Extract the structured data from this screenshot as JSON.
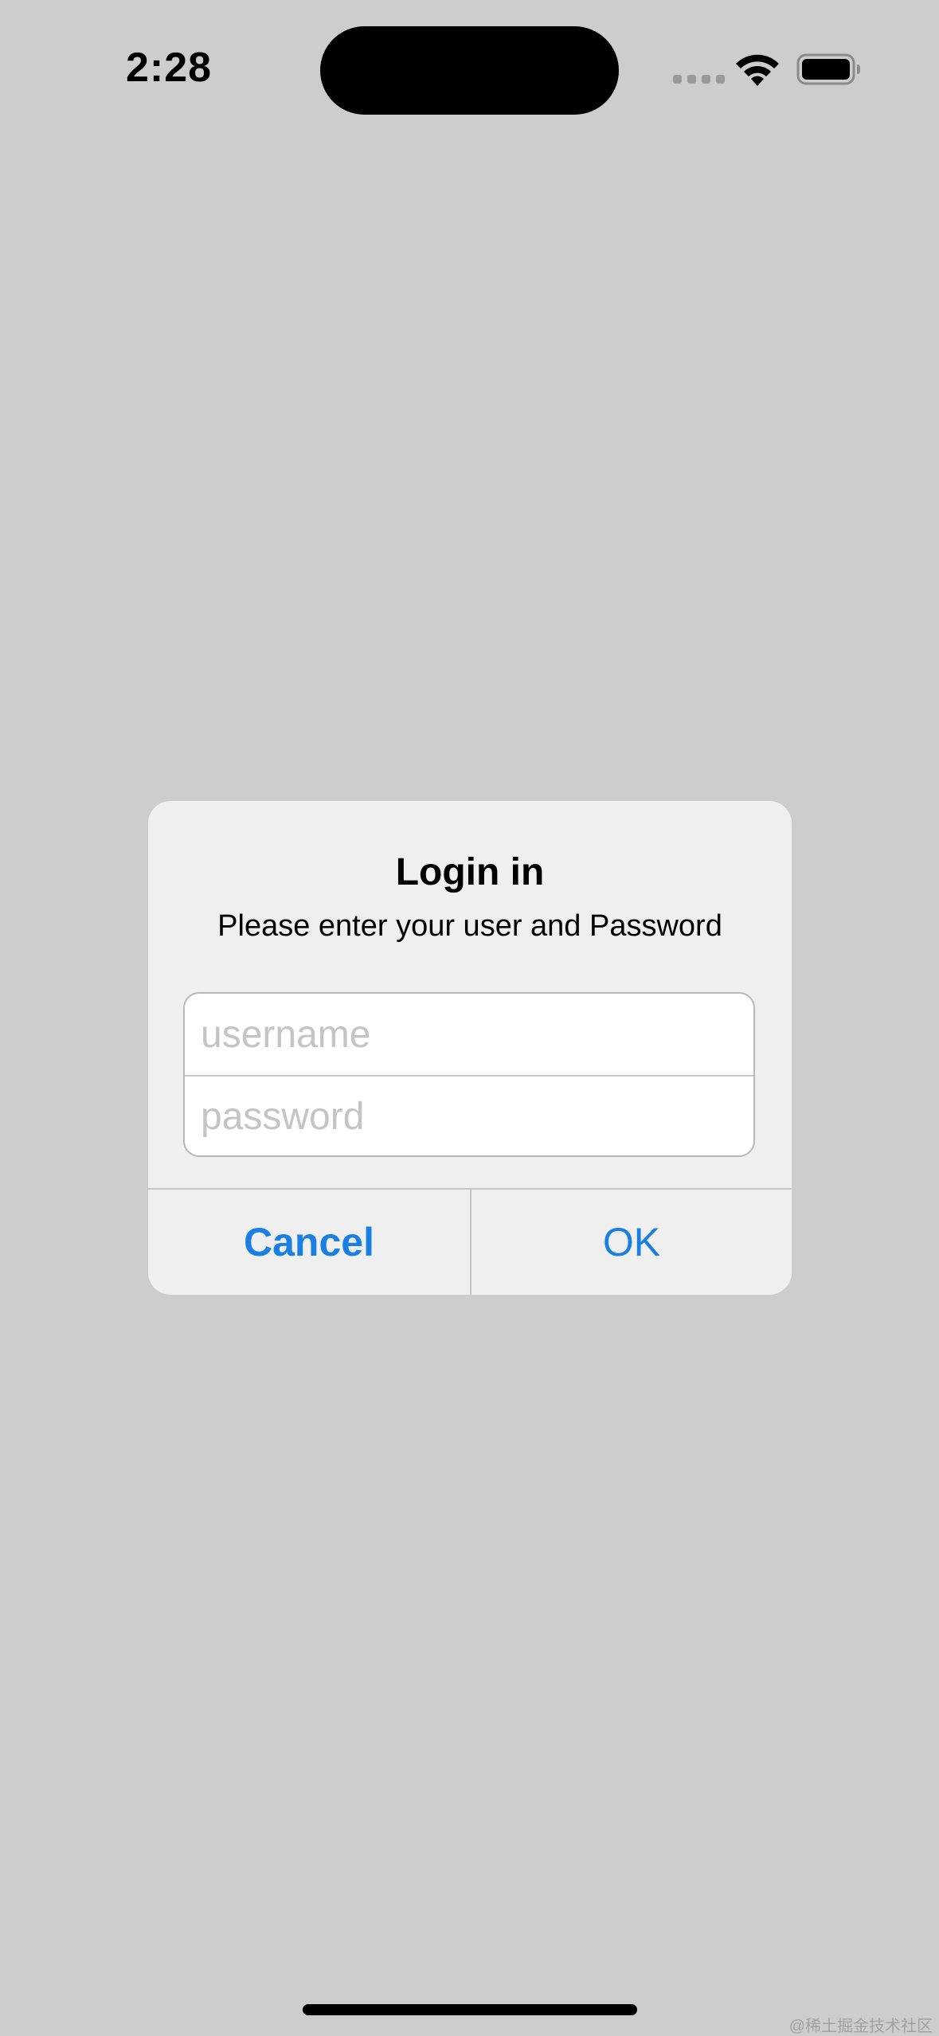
{
  "status_bar": {
    "time": "2:28",
    "icons": [
      "signal-dots-icon",
      "wifi-icon",
      "battery-icon"
    ]
  },
  "alert": {
    "title": "Login in",
    "message": "Please enter your user and Password",
    "fields": {
      "username_placeholder": "username",
      "username_value": "",
      "password_placeholder": "password",
      "password_value": ""
    },
    "buttons": {
      "cancel_label": "Cancel",
      "ok_label": "OK"
    }
  },
  "watermark": "@稀土掘金技术社区",
  "colors": {
    "background": "#cdcdcd",
    "alert_background": "#efefef",
    "accent": "#1a7fe2"
  }
}
